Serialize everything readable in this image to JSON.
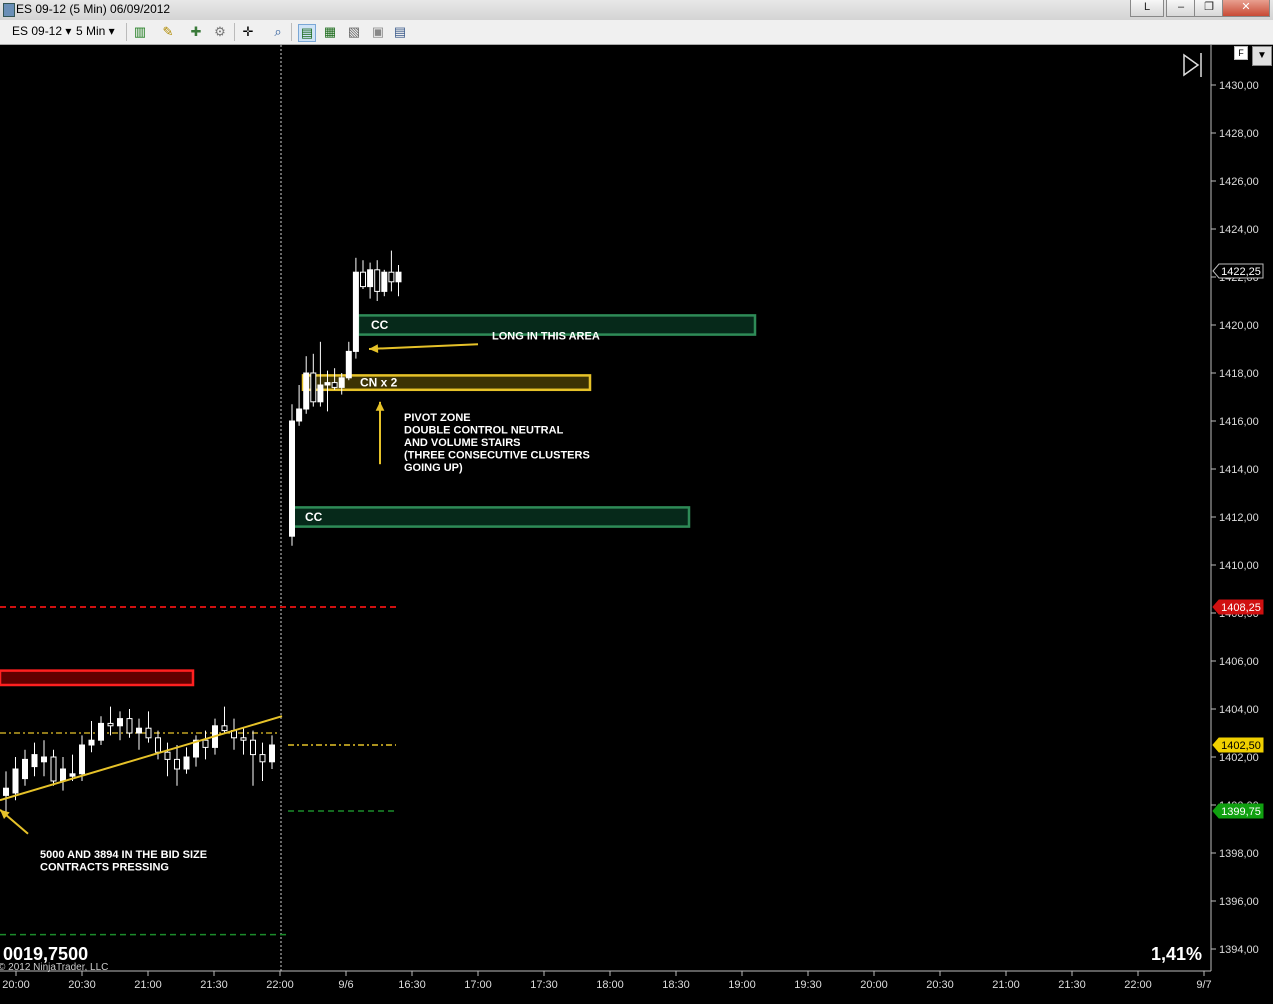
{
  "window": {
    "title": "ES 09-12 (5 Min)  06/09/2012",
    "buttons": [
      "L",
      "–",
      "❐",
      "✕"
    ]
  },
  "toolbar": {
    "instrument": "ES 09-12",
    "interval": "5 Min"
  },
  "footer": {
    "left_value": "0019,7500",
    "copyright": "© 2012 NinjaTrader, LLC",
    "right_value": "1,41%"
  },
  "chart_data": {
    "type": "candlestick",
    "y_ticks": [
      "1430,00",
      "1428,00",
      "1426,00",
      "1424,00",
      "1422,00",
      "1420,00",
      "1418,00",
      "1416,00",
      "1414,00",
      "1412,00",
      "1410,00",
      "1408,00",
      "1406,00",
      "1404,00",
      "1402,00",
      "1400,00",
      "1398,00",
      "1396,00",
      "1394,00"
    ],
    "x_ticks": [
      "20:00",
      "20:30",
      "21:00",
      "21:30",
      "22:00",
      "9/6",
      "16:30",
      "17:00",
      "17:30",
      "18:00",
      "18:30",
      "19:00",
      "19:30",
      "20:00",
      "20:30",
      "21:00",
      "21:30",
      "22:00",
      "9/7"
    ],
    "price_labels": [
      {
        "value": "1422,25",
        "color": "#000000"
      },
      {
        "value": "1408,25",
        "color": "#d01010"
      },
      {
        "value": "1402,50",
        "color": "#f0d000"
      },
      {
        "value": "1399,75",
        "color": "#10a010"
      }
    ],
    "candles_prev": [
      {
        "o": 1400.4,
        "h": 1401.4,
        "l": 1399.7,
        "c": 1400.7
      },
      {
        "o": 1400.5,
        "h": 1402.0,
        "l": 1400.2,
        "c": 1401.5
      },
      {
        "o": 1401.1,
        "h": 1402.3,
        "l": 1400.8,
        "c": 1401.9
      },
      {
        "o": 1401.6,
        "h": 1402.6,
        "l": 1401.2,
        "c": 1402.1
      },
      {
        "o": 1401.8,
        "h": 1402.7,
        "l": 1401.2,
        "c": 1402.0
      },
      {
        "o": 1402.0,
        "h": 1402.3,
        "l": 1400.8,
        "c": 1401.0
      },
      {
        "o": 1401.0,
        "h": 1402.0,
        "l": 1400.6,
        "c": 1401.5
      },
      {
        "o": 1401.2,
        "h": 1402.1,
        "l": 1401.0,
        "c": 1401.3
      },
      {
        "o": 1401.3,
        "h": 1402.9,
        "l": 1401.0,
        "c": 1402.5
      },
      {
        "o": 1402.5,
        "h": 1403.5,
        "l": 1402.2,
        "c": 1402.7
      },
      {
        "o": 1402.7,
        "h": 1403.7,
        "l": 1402.5,
        "c": 1403.4
      },
      {
        "o": 1403.4,
        "h": 1404.1,
        "l": 1402.9,
        "c": 1403.3
      },
      {
        "o": 1403.3,
        "h": 1403.9,
        "l": 1402.7,
        "c": 1403.6
      },
      {
        "o": 1403.6,
        "h": 1404.0,
        "l": 1402.8,
        "c": 1403.0
      },
      {
        "o": 1403.0,
        "h": 1403.6,
        "l": 1402.3,
        "c": 1403.2
      },
      {
        "o": 1403.2,
        "h": 1403.9,
        "l": 1402.6,
        "c": 1402.8
      },
      {
        "o": 1402.8,
        "h": 1403.1,
        "l": 1401.9,
        "c": 1402.2
      },
      {
        "o": 1402.2,
        "h": 1402.6,
        "l": 1401.2,
        "c": 1401.9
      },
      {
        "o": 1401.9,
        "h": 1402.5,
        "l": 1400.8,
        "c": 1401.5
      },
      {
        "o": 1401.5,
        "h": 1402.4,
        "l": 1401.3,
        "c": 1402.0
      },
      {
        "o": 1402.0,
        "h": 1402.9,
        "l": 1401.6,
        "c": 1402.7
      },
      {
        "o": 1402.7,
        "h": 1403.1,
        "l": 1401.9,
        "c": 1402.4
      },
      {
        "o": 1402.4,
        "h": 1403.6,
        "l": 1402.1,
        "c": 1403.3
      },
      {
        "o": 1403.3,
        "h": 1404.1,
        "l": 1403.0,
        "c": 1403.1
      },
      {
        "o": 1403.1,
        "h": 1403.6,
        "l": 1402.3,
        "c": 1402.8
      },
      {
        "o": 1402.8,
        "h": 1403.2,
        "l": 1402.1,
        "c": 1402.7
      },
      {
        "o": 1402.7,
        "h": 1403.1,
        "l": 1400.8,
        "c": 1402.1
      },
      {
        "o": 1402.1,
        "h": 1402.6,
        "l": 1401.0,
        "c": 1401.8
      },
      {
        "o": 1401.8,
        "h": 1402.9,
        "l": 1401.5,
        "c": 1402.5
      }
    ],
    "candles_today": [
      {
        "o": 1411.2,
        "h": 1416.7,
        "l": 1410.8,
        "c": 1416.0
      },
      {
        "o": 1416.0,
        "h": 1417.5,
        "l": 1415.8,
        "c": 1416.5
      },
      {
        "o": 1416.5,
        "h": 1418.7,
        "l": 1416.3,
        "c": 1418.0
      },
      {
        "o": 1418.0,
        "h": 1418.8,
        "l": 1416.6,
        "c": 1416.8
      },
      {
        "o": 1416.8,
        "h": 1419.3,
        "l": 1416.6,
        "c": 1417.5
      },
      {
        "o": 1417.5,
        "h": 1418.1,
        "l": 1416.4,
        "c": 1417.6
      },
      {
        "o": 1417.6,
        "h": 1418.2,
        "l": 1417.3,
        "c": 1417.4
      },
      {
        "o": 1417.4,
        "h": 1418.0,
        "l": 1417.1,
        "c": 1417.8
      },
      {
        "o": 1417.8,
        "h": 1419.3,
        "l": 1417.7,
        "c": 1418.9
      },
      {
        "o": 1418.9,
        "h": 1422.8,
        "l": 1418.6,
        "c": 1422.2
      },
      {
        "o": 1422.2,
        "h": 1422.7,
        "l": 1421.5,
        "c": 1421.6
      },
      {
        "o": 1421.6,
        "h": 1422.6,
        "l": 1421.1,
        "c": 1422.3
      },
      {
        "o": 1422.3,
        "h": 1422.7,
        "l": 1421.0,
        "c": 1421.4
      },
      {
        "o": 1421.4,
        "h": 1422.3,
        "l": 1421.2,
        "c": 1422.2
      },
      {
        "o": 1422.2,
        "h": 1423.1,
        "l": 1421.4,
        "c": 1421.8
      },
      {
        "o": 1421.8,
        "h": 1422.5,
        "l": 1421.2,
        "c": 1422.2
      }
    ],
    "zones": [
      {
        "label": "CC",
        "color": "#2e8b57",
        "fill": "#06291a",
        "low": 1419.6,
        "high": 1420.4
      },
      {
        "label": "CN x 2",
        "color": "#e6c229",
        "fill": "#3b3204",
        "low": 1417.3,
        "high": 1417.9
      },
      {
        "label": "CC",
        "color": "#2e8b57",
        "fill": "#06291a",
        "low": 1411.6,
        "high": 1412.4
      },
      {
        "label": "",
        "color": "#ff2020",
        "fill": "#600000",
        "low": 1405.0,
        "high": 1405.6
      }
    ],
    "horizontal_levels": [
      {
        "value": 1408.25,
        "color": "#d01010",
        "style": "dashed"
      },
      {
        "value": 1402.5,
        "color": "#e6c229",
        "style": "dashdot"
      },
      {
        "value": 1399.75,
        "color": "#1a8c2a",
        "style": "dashed"
      },
      {
        "value": 1394.6,
        "color": "#1a8c2a",
        "style": "dashed"
      }
    ],
    "annotations": [
      {
        "lines": [
          "LONG IN THIS AREA"
        ]
      },
      {
        "lines": [
          "PIVOT ZONE",
          "DOUBLE CONTROL NEUTRAL",
          "AND VOLUME STAIRS",
          "(THREE CONSECUTIVE CLUSTERS",
          "GOING UP)"
        ]
      },
      {
        "lines": [
          "5000 AND 3894 IN THE BID SIZE",
          "CONTRACTS PRESSING"
        ]
      }
    ],
    "ylim": [
      1393.5,
      1431.5
    ]
  }
}
